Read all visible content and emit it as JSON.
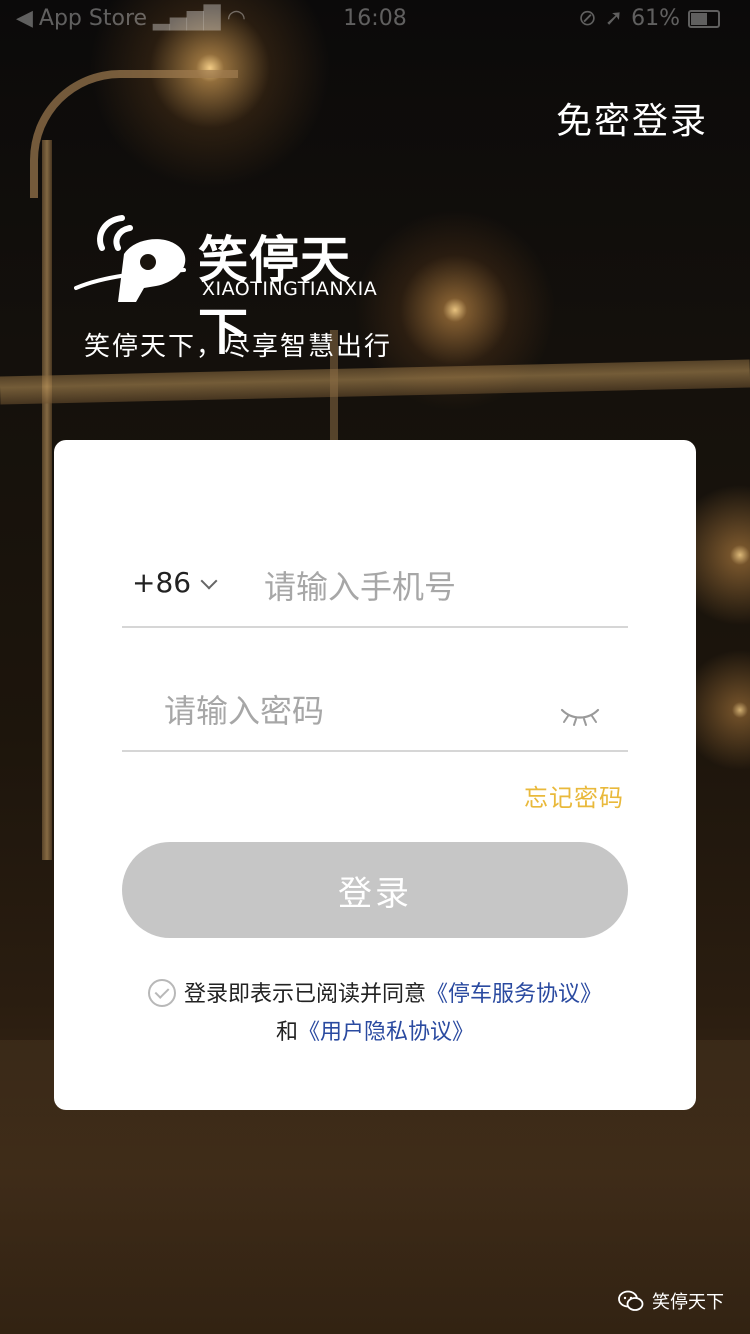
{
  "status_bar": {
    "back_app": "App Store",
    "time": "16:08",
    "battery": "61%"
  },
  "header": {
    "passwordless_login": "免密登录"
  },
  "brand": {
    "name_cn": "笑停天下",
    "name_en": "XIAOTINGTIANXIA",
    "slogan": "笑停天下，尽享智慧出行"
  },
  "form": {
    "country_code": "+86",
    "phone_placeholder": "请输入手机号",
    "password_placeholder": "请输入密码",
    "forgot_password": "忘记密码",
    "login_button": "登录"
  },
  "agreement": {
    "prefix": "登录即表示已阅读并同意",
    "parking_agreement": "《停车服务协议》",
    "conjunction": "和",
    "privacy_agreement": "《用户隐私协议》"
  },
  "watermark": {
    "account": "笑停天下"
  },
  "colors": {
    "accent_yellow": "#e9b93b",
    "link_blue": "#2a4aa0",
    "button_disabled": "#c6c6c6"
  }
}
